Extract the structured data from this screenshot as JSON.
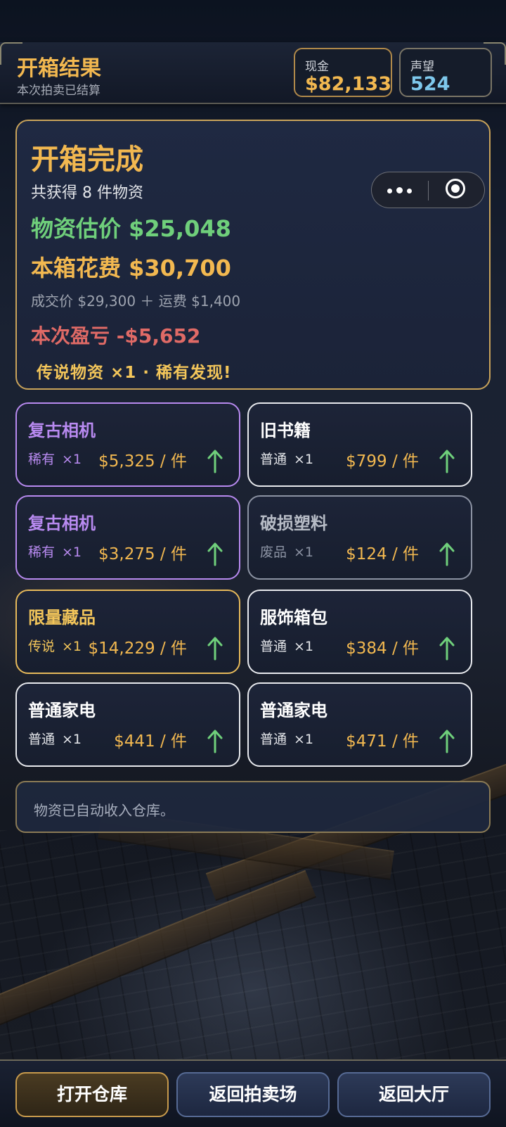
{
  "header": {
    "title": "开箱结果",
    "subtitle": "本次拍卖已结算",
    "cash_label": "现金",
    "cash_value": "$82,133",
    "fame_label": "声望",
    "fame_value": "524"
  },
  "summary": {
    "title": "开箱完成",
    "count_text": "共获得 8 件物资",
    "estimate_text": "物资估价 $25,048",
    "cost_text": "本箱花费 $30,700",
    "breakdown_text": "成交价 $29,300 ＋ 运费 $1,400",
    "profit_text": "本次盈亏 -$5,652",
    "bonus_text": "传说物资 ×1 · 稀有发现!"
  },
  "items": [
    {
      "name": "复古相机",
      "tier": "稀有",
      "qty": "×1",
      "price": "$5,325 / 件",
      "rarity": "rare"
    },
    {
      "name": "旧书籍",
      "tier": "普通",
      "qty": "×1",
      "price": "$799 / 件",
      "rarity": "common"
    },
    {
      "name": "复古相机",
      "tier": "稀有",
      "qty": "×1",
      "price": "$3,275 / 件",
      "rarity": "rare"
    },
    {
      "name": "破损塑料",
      "tier": "废品",
      "qty": "×1",
      "price": "$124 / 件",
      "rarity": "junk"
    },
    {
      "name": "限量藏品",
      "tier": "传说",
      "qty": "×1",
      "price": "$14,229 / 件",
      "rarity": "legendary"
    },
    {
      "name": "服饰箱包",
      "tier": "普通",
      "qty": "×1",
      "price": "$384 / 件",
      "rarity": "common"
    },
    {
      "name": "普通家电",
      "tier": "普通",
      "qty": "×1",
      "price": "$441 / 件",
      "rarity": "common"
    },
    {
      "name": "普通家电",
      "tier": "普通",
      "qty": "×1",
      "price": "$471 / 件",
      "rarity": "common"
    }
  ],
  "notice": "物资已自动收入仓库。",
  "buttons": {
    "open_warehouse": "打开仓库",
    "back_auction": "返回拍卖场",
    "back_lobby": "返回大厅"
  },
  "icons": {
    "trend": "arrow-up-icon",
    "more": "more-dots-icon",
    "close": "miniprogram-close-icon"
  },
  "colors": {
    "gold": "#f2b850",
    "profit_green": "#6fcf7b",
    "loss_red": "#e06a66",
    "rare_purple": "#b88af0",
    "legend_gold": "#f2c55a",
    "fame_blue": "#7ec8ec"
  }
}
